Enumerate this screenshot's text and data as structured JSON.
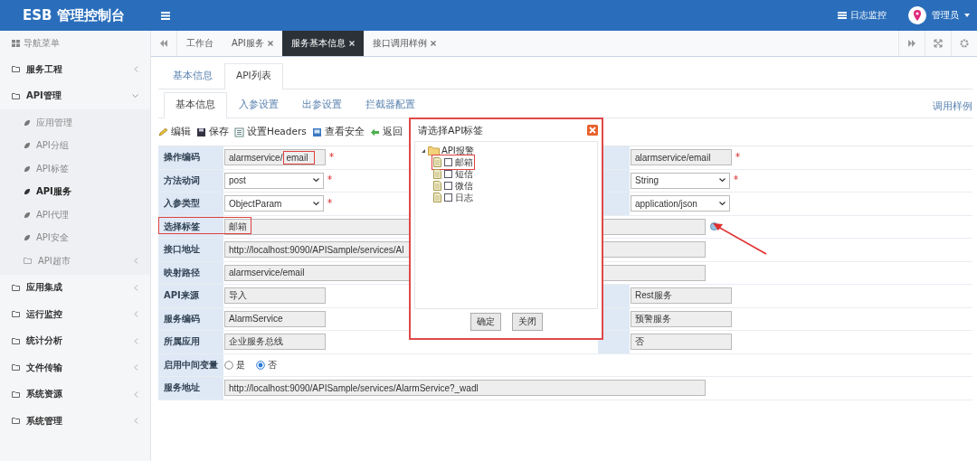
{
  "header": {
    "title": "ESB 管理控制台",
    "links": [
      {
        "label": "日志监控"
      }
    ],
    "user": {
      "name": "管理员"
    }
  },
  "sidebar": {
    "heading": "导航菜单",
    "items": [
      {
        "label": "服务工程",
        "expanded": false
      },
      {
        "label": "API管理",
        "expanded": true,
        "children": [
          {
            "label": "应用管理",
            "kind": "leaf",
            "selected": false
          },
          {
            "label": "API分组",
            "kind": "leaf",
            "selected": false
          },
          {
            "label": "API标签",
            "kind": "leaf",
            "selected": false
          },
          {
            "label": "API服务",
            "kind": "leaf",
            "selected": true
          },
          {
            "label": "API代理",
            "kind": "leaf",
            "selected": false
          },
          {
            "label": "API安全",
            "kind": "leaf",
            "selected": false
          },
          {
            "label": "API超市",
            "kind": "folder",
            "selected": false
          }
        ]
      },
      {
        "label": "应用集成",
        "expanded": false
      },
      {
        "label": "运行监控",
        "expanded": false
      },
      {
        "label": "统计分析",
        "expanded": false
      },
      {
        "label": "文件传输",
        "expanded": false
      },
      {
        "label": "系统资源",
        "expanded": false
      },
      {
        "label": "系统管理",
        "expanded": false
      }
    ]
  },
  "page_tabs": [
    {
      "label": "工作台",
      "closable": false,
      "selected": false
    },
    {
      "label": "API服务",
      "closable": true,
      "selected": false
    },
    {
      "label": "服务基本信息",
      "closable": true,
      "selected": true
    },
    {
      "label": "接口调用样例",
      "closable": true,
      "selected": false
    }
  ],
  "section_tabs": [
    {
      "label": "基本信息",
      "selected": false
    },
    {
      "label": "API列表",
      "selected": true
    }
  ],
  "detail_tabs": [
    {
      "label": "基本信息",
      "selected": true
    },
    {
      "label": "入参设置",
      "selected": false
    },
    {
      "label": "出参设置",
      "selected": false
    },
    {
      "label": "拦截器配置",
      "selected": false
    }
  ],
  "detail_link": "调用样例",
  "toolbar": [
    {
      "label": "编辑",
      "kind": "edit"
    },
    {
      "label": "保存",
      "kind": "save"
    },
    {
      "label": "设置Headers",
      "kind": "headers"
    },
    {
      "label": "查看安全",
      "kind": "security"
    },
    {
      "label": "返回",
      "kind": "back"
    }
  ],
  "form_rows": [
    {
      "label": "操作编码",
      "kind": "text",
      "value_parts": [
        {
          "text": "alarmservice/",
          "marked": false
        },
        {
          "text": "email",
          "marked": true
        }
      ],
      "required": true,
      "right": {
        "kind": "text",
        "value": "alarmservice/email",
        "required": true
      }
    },
    {
      "label": "方法动词",
      "kind": "select",
      "value": "post",
      "required": true,
      "right": {
        "kind": "select",
        "value": "String",
        "required": true
      }
    },
    {
      "label": "入参类型",
      "kind": "select",
      "value": "ObjectParam",
      "required": true,
      "right": {
        "kind": "select",
        "value": "application/json",
        "required": false
      }
    },
    {
      "label": "选择标签",
      "kind": "wide",
      "value": "邮箱",
      "annotated": true,
      "picker": true,
      "pointer_arrow": true
    },
    {
      "label": "接口地址",
      "kind": "wide",
      "value": "http://localhost:9090/APISample/services/Al"
    },
    {
      "label": "映射路径",
      "kind": "wide",
      "value": "alarmservice/email"
    },
    {
      "label": "API来源",
      "kind": "text",
      "value": "导入",
      "right": {
        "kind": "text",
        "value": "Rest服务"
      }
    },
    {
      "label": "服务编码",
      "kind": "text",
      "value": "AlarmService",
      "right": {
        "kind": "text",
        "value": "预警服务"
      }
    },
    {
      "label": "所属应用",
      "kind": "text",
      "value": "企业服务总线",
      "right": {
        "kind": "text",
        "value": "否"
      }
    },
    {
      "label": "启用中间变量",
      "kind": "radio",
      "options": [
        {
          "label": "是",
          "selected": false
        },
        {
          "label": "否",
          "selected": true
        }
      ]
    },
    {
      "label": "服务地址",
      "kind": "wide",
      "value": "http://localhost:9090/APISample/services/AlarmService?_wadl"
    }
  ],
  "dialog": {
    "title": "请选择API标签",
    "annotated": true,
    "tree": [
      {
        "label": "API报警",
        "expanded": true,
        "children": [
          {
            "label": "邮箱",
            "checked": false,
            "annotated": true
          },
          {
            "label": "短信",
            "checked": false,
            "annotated": false
          },
          {
            "label": "微信",
            "checked": false,
            "annotated": false
          },
          {
            "label": "日志",
            "checked": false,
            "annotated": false
          }
        ]
      }
    ],
    "buttons": [
      "确定",
      "关闭"
    ]
  }
}
